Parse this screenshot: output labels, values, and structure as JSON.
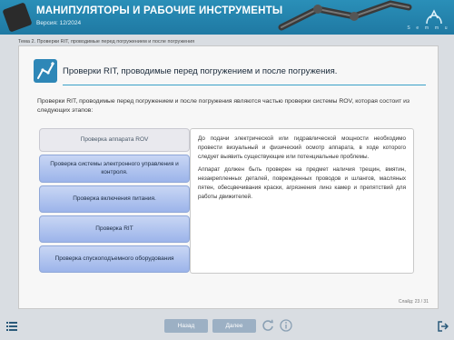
{
  "header": {
    "title": "МАНИПУЛЯТОРЫ И РАБОЧИЕ ИНСТРУМЕНТЫ",
    "version": "Версия: 12/2024",
    "brand_text": "S  e  m  m  u"
  },
  "breadcrumb": "Тема 2. Проверки RIT, проводимые перед погружением и после погружения",
  "page": {
    "title": "Проверки RIT, проводимые перед погружением и после погружения.",
    "intro": "Проверки RIT, проводимые перед погружением и после погружения являются частью проверки системы ROV, которая состоит из следующих этапов:"
  },
  "steps": [
    {
      "label": "Проверка аппарата ROV"
    },
    {
      "label": "Проверка системы электронного управления и контроля."
    },
    {
      "label": "Проверка включения питания."
    },
    {
      "label": "Проверка RIT"
    },
    {
      "label": "Проверка спускоподъемного оборудования"
    }
  ],
  "panel": {
    "p1": "До подачи электрической или гидравлической мощности необходимо провести визуальный и физический осмотр аппарата, в ходе которого следует выявить существующие или потенциальные проблемы.",
    "p2": "Аппарат должен быть проверен на предмет наличия трещин, вмятин, незакрепленных деталей, поврежденных проводов и шлангов, масляных пятен, обесцвечивания краски, агрязнения линз камер и препятствий для работы движителей."
  },
  "slide_counter": "Слайд: 23 / 31",
  "footer": {
    "back_label": "Назад",
    "next_label": "Далее"
  },
  "colors": {
    "header": "#1f79a3",
    "accent": "#3aa0c8",
    "step_button": "#9cb4ea",
    "nav_button": "#9cb0c4"
  },
  "icons": [
    "robot-arm-icon",
    "hamburger-menu-icon",
    "reload-icon",
    "info-icon",
    "exit-icon",
    "brand-logo-icon"
  ]
}
